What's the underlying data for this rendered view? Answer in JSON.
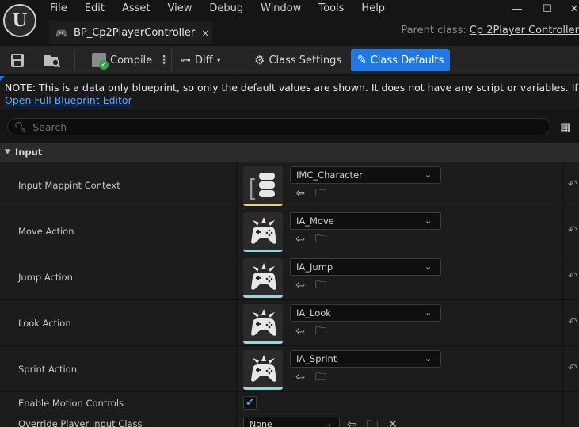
{
  "menu": [
    "File",
    "Edit",
    "Asset",
    "View",
    "Debug",
    "Window",
    "Tools",
    "Help"
  ],
  "window_controls": {
    "minimize": "—",
    "maximize": "☐",
    "close": "✕"
  },
  "tab": {
    "title": "BP_Cp2PlayerController",
    "close": "×"
  },
  "parent_class": {
    "label": "Parent class:",
    "value": "Cp 2Player Controller"
  },
  "toolbar": {
    "compile_label": "Compile",
    "diff_label": "Diff",
    "class_settings_label": "Class Settings",
    "class_defaults_label": "Class Defaults"
  },
  "note": {
    "text": "NOTE: This is a data only blueprint, so only the default values are shown.  It does not have any script or variables.  If you want",
    "link": "Open Full Blueprint Editor"
  },
  "search": {
    "placeholder": "Search"
  },
  "category": {
    "title": "Input"
  },
  "properties": [
    {
      "name": "Input Mappint Context",
      "value": "IMC_Character"
    },
    {
      "name": "Move Action",
      "value": "IA_Move"
    },
    {
      "name": "Jump Action",
      "value": "IA_Jump"
    },
    {
      "name": "Look Action",
      "value": "IA_Look"
    },
    {
      "name": "Sprint Action",
      "value": "IA_Sprint"
    }
  ],
  "enable_motion": {
    "name": "Enable Motion Controls",
    "checked": true
  },
  "override": {
    "name": "Override Player Input Class",
    "value": "None"
  },
  "colors": {
    "accent": "#1f78e6",
    "imc_bar": "#e8d66a",
    "ia_bar": "#7fe0e0"
  }
}
